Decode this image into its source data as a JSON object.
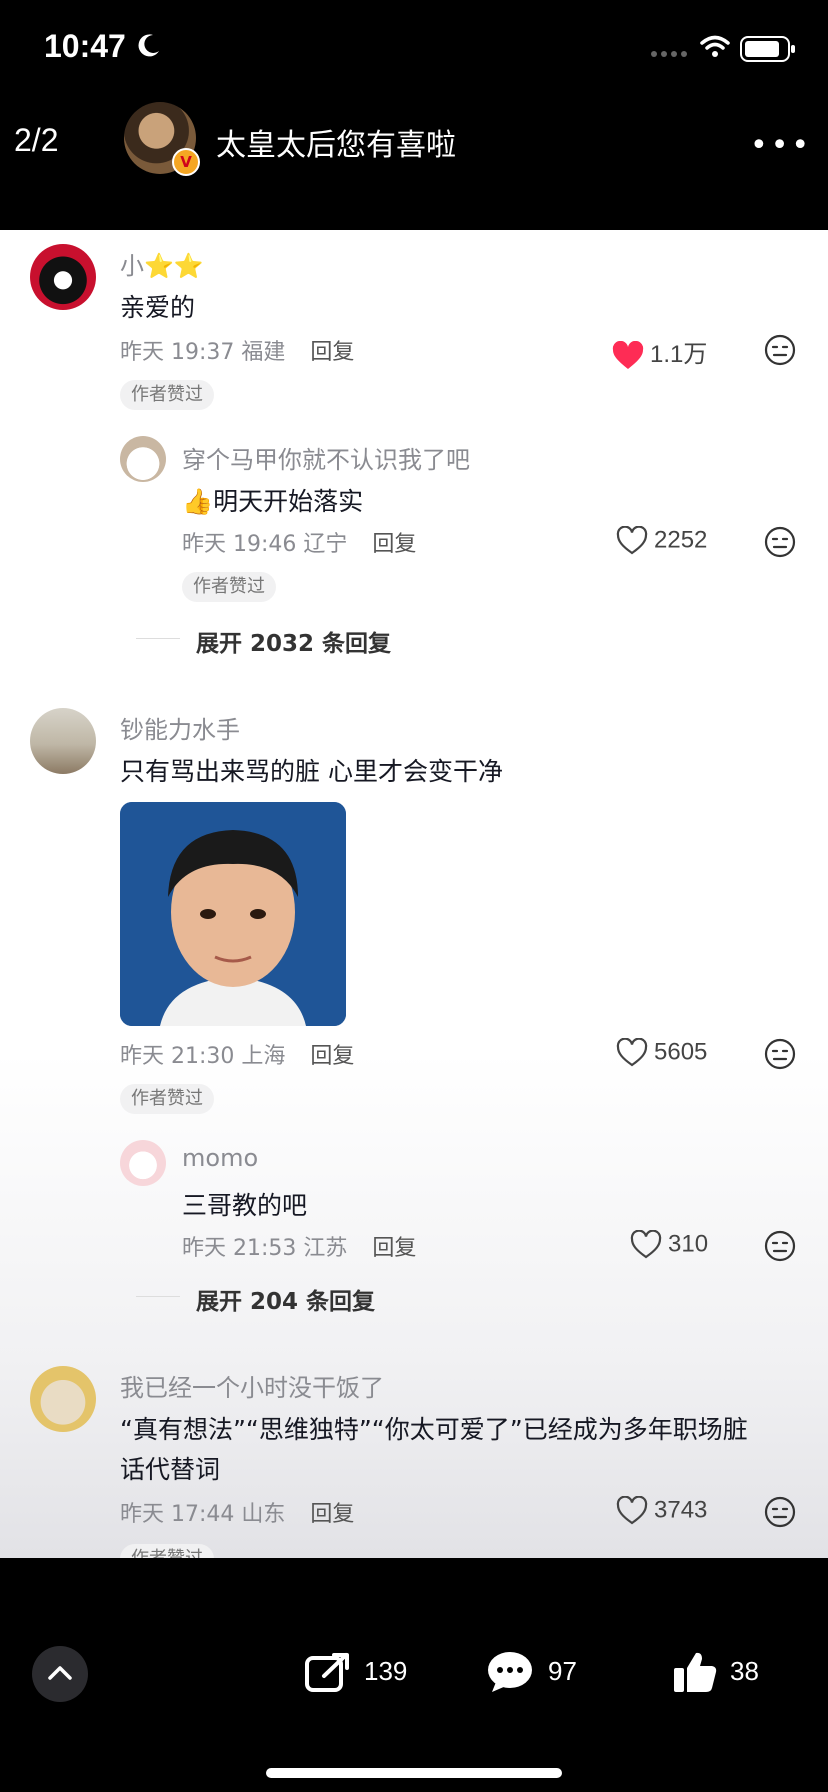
{
  "status_bar": {
    "time": "10:47"
  },
  "header": {
    "counter": "2/2",
    "account_name": "太皇太后您有喜啦",
    "verified_badge": "V"
  },
  "comments": [
    {
      "user": "小⭐⭐",
      "text": "亲爱的",
      "time": "昨天 19:37",
      "location": "福建",
      "reply": "回复",
      "likes": "1.1万",
      "liked": true,
      "tag": "作者赞过",
      "replies": [
        {
          "user": "穿个马甲你就不认识我了吧",
          "text": "👍明天开始落实",
          "time": "昨天 19:46",
          "location": "辽宁",
          "reply": "回复",
          "likes": "2252",
          "tag": "作者赞过"
        }
      ],
      "expand": "展开 2032 条回复"
    },
    {
      "user": "钞能力水手",
      "text": "只有骂出来骂的脏 心里才会变干净",
      "time": "昨天 21:30",
      "location": "上海",
      "reply": "回复",
      "likes": "5605",
      "tag": "作者赞过",
      "replies": [
        {
          "user": "momo",
          "text": "三哥教的吧",
          "time": "昨天 21:53",
          "location": "江苏",
          "reply": "回复",
          "likes": "310"
        }
      ],
      "expand": "展开 204 条回复"
    },
    {
      "user": "我已经一个小时没干饭了",
      "text_line1": "“真有想法”“思维独特”“你太可爱了”已经成为多年职场脏",
      "text_line2": "话代替词",
      "time": "昨天 17:44",
      "location": "山东",
      "reply": "回复",
      "likes": "3743",
      "tag": "作者赞过"
    }
  ],
  "bottom_bar": {
    "share_count": "139",
    "comment_count": "97",
    "like_count": "38"
  },
  "icons": [
    "moon-icon",
    "signal-icon",
    "wifi-icon",
    "battery-icon",
    "more-icon",
    "heart-icon",
    "face-icon",
    "share-icon",
    "comment-icon",
    "thumbs-up-icon",
    "chevron-up-icon"
  ],
  "colors": {
    "liked_heart": "#fe2c55",
    "background": "#ffffff",
    "bar": "#000000"
  }
}
